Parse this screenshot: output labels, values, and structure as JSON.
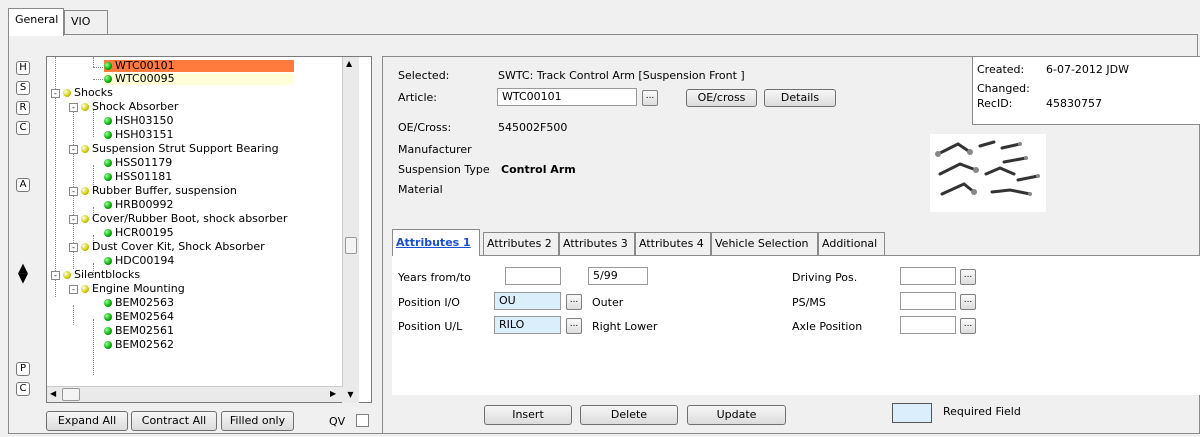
{
  "top_tabs": [
    "General",
    "VIO"
  ],
  "side_letters_top": [
    "H",
    "S",
    "R",
    "C",
    "A"
  ],
  "side_letters_bottom": [
    "P",
    "C"
  ],
  "tree": [
    {
      "label": "WTC00101",
      "icon": "green",
      "state": "selected"
    },
    {
      "label": "WTC00095",
      "icon": "green",
      "state": "hover"
    },
    {
      "label": "Shocks",
      "icon": "yellow",
      "toggle": "-"
    },
    {
      "label": "Shock Absorber",
      "icon": "yellow",
      "toggle": "-"
    },
    {
      "label": "HSH03150",
      "icon": "green"
    },
    {
      "label": "HSH03151",
      "icon": "green"
    },
    {
      "label": "Suspension Strut Support Bearing",
      "icon": "yellow",
      "toggle": "-"
    },
    {
      "label": "HSS01179",
      "icon": "green"
    },
    {
      "label": "HSS01181",
      "icon": "green"
    },
    {
      "label": "Rubber Buffer, suspension",
      "icon": "yellow",
      "toggle": "-"
    },
    {
      "label": "HRB00992",
      "icon": "green"
    },
    {
      "label": "Cover/Rubber Boot, shock absorber",
      "icon": "yellow",
      "toggle": "-"
    },
    {
      "label": "HCR00195",
      "icon": "green"
    },
    {
      "label": "Dust Cover Kit, Shock Absorber",
      "icon": "yellow",
      "toggle": "-"
    },
    {
      "label": "HDC00194",
      "icon": "green"
    },
    {
      "label": "Silentblocks",
      "icon": "yellow",
      "toggle": "-"
    },
    {
      "label": "Engine Mounting",
      "icon": "yellow",
      "toggle": "-"
    },
    {
      "label": "BEM02563",
      "icon": "green"
    },
    {
      "label": "BEM02564",
      "icon": "green"
    },
    {
      "label": "BEM02561",
      "icon": "green"
    },
    {
      "label": "BEM02562",
      "icon": "green"
    }
  ],
  "tree_buttons": {
    "expand_all": "Expand All",
    "contract_all": "Contract All",
    "filled_only": "Filled only",
    "qv_label": "QV"
  },
  "details": {
    "selected_label": "Selected:",
    "selected_value": "SWTC: Track Control Arm [Suspension Front ]",
    "article_label": "Article:",
    "article_value": "WTC00101",
    "oe_cross_button": "OE/cross",
    "details_button": "Details",
    "oe_cross_label": "OE/Cross:",
    "oe_cross_value": "545002F500",
    "manufacturer_label": "Manufacturer",
    "suspension_type_label": "Suspension Type",
    "suspension_type_value": "Control Arm",
    "material_label": "Material"
  },
  "info": {
    "created_label": "Created:",
    "created_value": "6-07-2012 JDW",
    "changed_label": "Changed:",
    "recid_label": "RecID:",
    "recid_value": "45830757"
  },
  "attr_tabs": [
    "Attributes 1",
    "Attributes 2",
    "Attributes 3",
    "Attributes 4",
    "Vehicle Selection",
    "Additional"
  ],
  "attributes": {
    "years_label": "Years from/to",
    "years_from": "",
    "years_to": "5/99",
    "position_io_label": "Position I/O",
    "position_io_value": "OU",
    "position_io_text": "Outer",
    "position_ul_label": "Position U/L",
    "position_ul_value": "RILO",
    "position_ul_text": "Right Lower",
    "driving_pos_label": "Driving Pos.",
    "driving_pos_value": "",
    "psms_label": "PS/MS",
    "psms_value": "",
    "axle_label": "Axle Position",
    "axle_value": ""
  },
  "actions": {
    "insert": "Insert",
    "delete": "Delete",
    "update": "Update",
    "required_field": "Required Field"
  },
  "colors": {
    "selected_row": "#ff7a3c",
    "required_field": "#dbeefc",
    "active_tab_text": "#1a4fcf"
  }
}
